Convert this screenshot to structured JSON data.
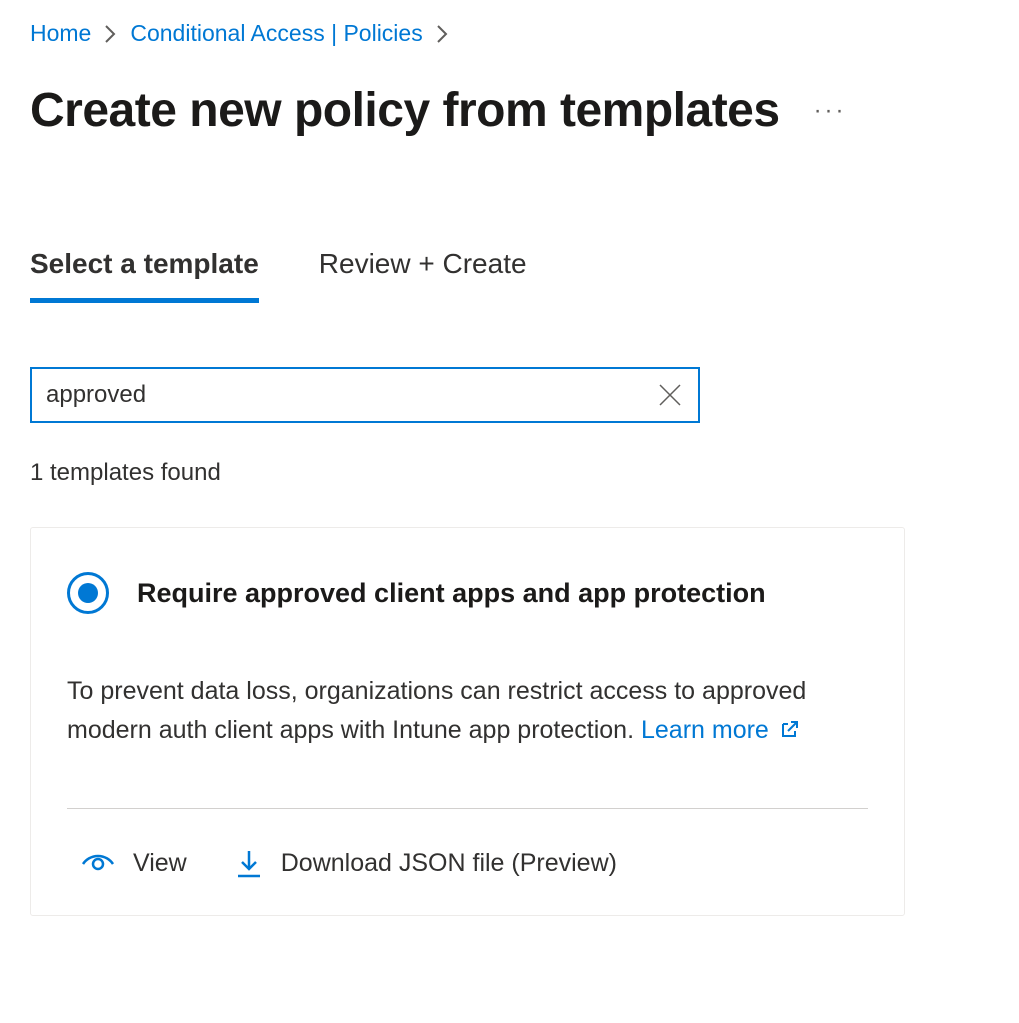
{
  "breadcrumb": {
    "home": "Home",
    "current": "Conditional Access | Policies"
  },
  "page": {
    "title": "Create new policy from templates"
  },
  "tabs": {
    "select": "Select a template",
    "review": "Review + Create"
  },
  "search": {
    "value": "approved"
  },
  "results": {
    "count_text": "1 templates found"
  },
  "template": {
    "title": "Require approved client apps and app protection",
    "description": "To prevent data loss, organizations can restrict access to approved modern auth client apps with Intune app protection. ",
    "learn_more": "Learn more",
    "actions": {
      "view": "View",
      "download": "Download JSON file (Preview)"
    }
  }
}
